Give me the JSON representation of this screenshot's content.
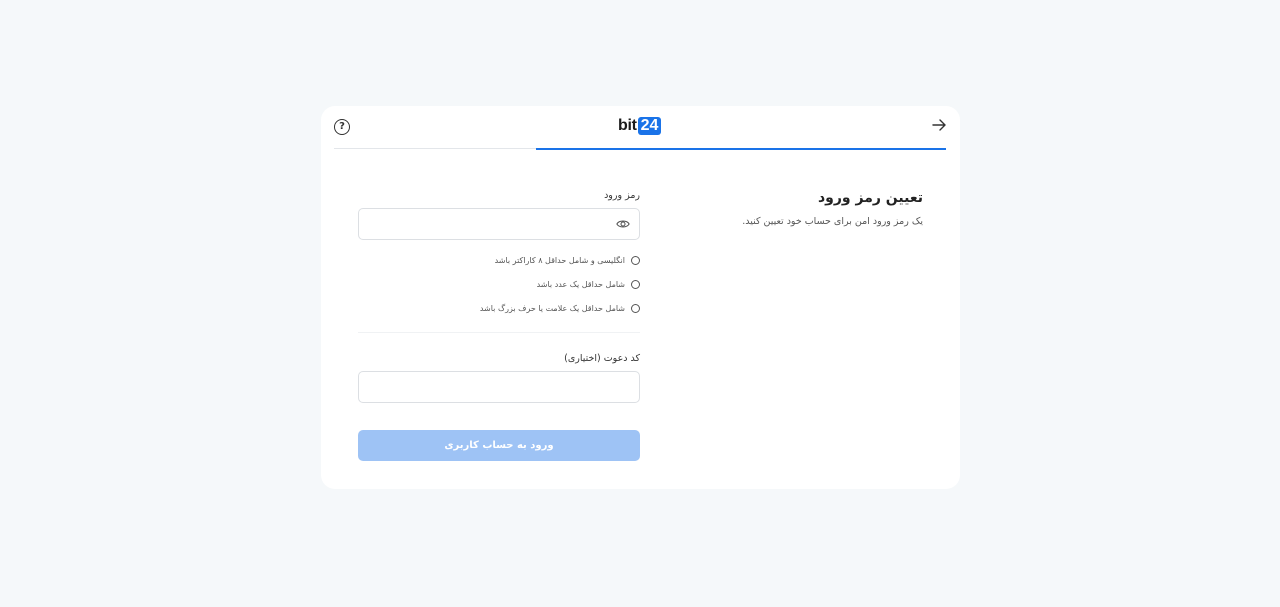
{
  "header": {
    "help_icon": "question-circle-icon",
    "help_glyph": "?",
    "logo_text_main": "bit",
    "logo_text_badge": "24",
    "back_icon": "arrow-right-icon",
    "progress_fraction": 0.67
  },
  "intro": {
    "title": "تعیین رمز ورود",
    "description": "یک رمز ورود امن برای حساب خود تعیین کنید."
  },
  "password": {
    "label": "رمز ورود",
    "value": "",
    "show_icon": "eye-icon"
  },
  "rules": [
    {
      "text": "انگلیسی و شامل حداقل ۸ کاراکتر باشد"
    },
    {
      "text": "شامل حداقل یک عدد باشد"
    },
    {
      "text": "شامل حداقل یک علامت یا حرف بزرگ باشد"
    }
  ],
  "invite": {
    "label": "کد دعوت (اختیاری)",
    "value": ""
  },
  "submit": {
    "label": "ورود به حساب کاربری"
  },
  "colors": {
    "accent": "#1a73e8",
    "submit_disabled": "#9ec3f5",
    "page_background": "#f5f8fa"
  }
}
